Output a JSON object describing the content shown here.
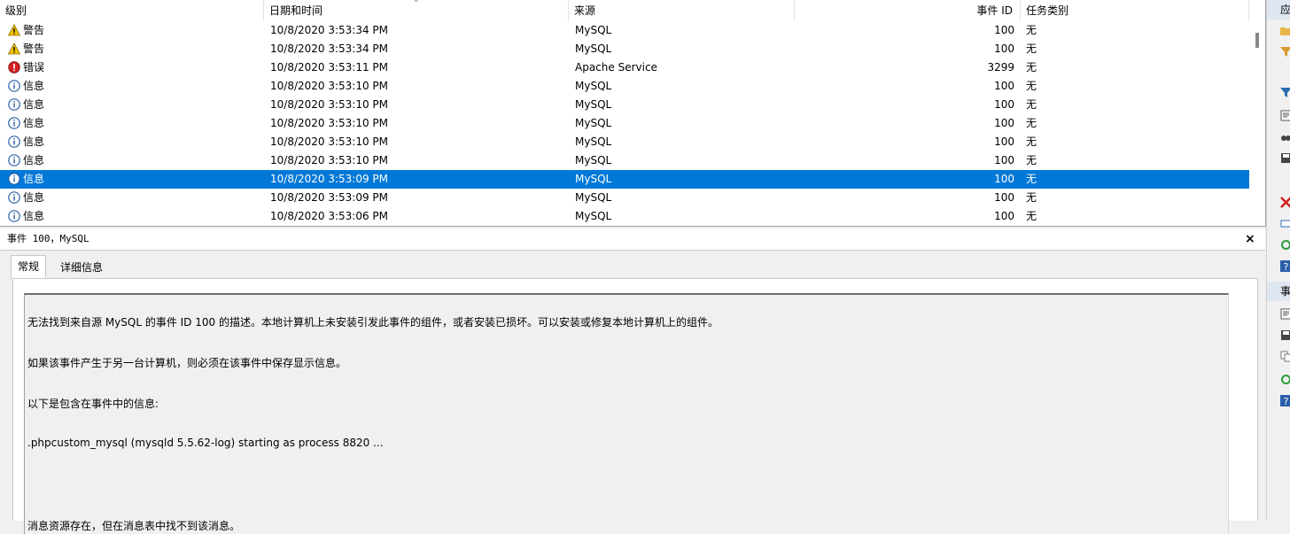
{
  "columns": {
    "level": "级别",
    "datetime": "日期和时间",
    "source": "来源",
    "event_id": "事件 ID",
    "task": "任务类别"
  },
  "rows": [
    {
      "level": "警告",
      "type": "warning",
      "datetime": "10/8/2020 3:53:34 PM",
      "source": "MySQL",
      "event_id": "100",
      "task": "无",
      "selected": false
    },
    {
      "level": "警告",
      "type": "warning",
      "datetime": "10/8/2020 3:53:34 PM",
      "source": "MySQL",
      "event_id": "100",
      "task": "无",
      "selected": false
    },
    {
      "level": "错误",
      "type": "error",
      "datetime": "10/8/2020 3:53:11 PM",
      "source": "Apache Service",
      "event_id": "3299",
      "task": "无",
      "selected": false
    },
    {
      "level": "信息",
      "type": "info",
      "datetime": "10/8/2020 3:53:10 PM",
      "source": "MySQL",
      "event_id": "100",
      "task": "无",
      "selected": false
    },
    {
      "level": "信息",
      "type": "info",
      "datetime": "10/8/2020 3:53:10 PM",
      "source": "MySQL",
      "event_id": "100",
      "task": "无",
      "selected": false
    },
    {
      "level": "信息",
      "type": "info",
      "datetime": "10/8/2020 3:53:10 PM",
      "source": "MySQL",
      "event_id": "100",
      "task": "无",
      "selected": false
    },
    {
      "level": "信息",
      "type": "info",
      "datetime": "10/8/2020 3:53:10 PM",
      "source": "MySQL",
      "event_id": "100",
      "task": "无",
      "selected": false
    },
    {
      "level": "信息",
      "type": "info",
      "datetime": "10/8/2020 3:53:10 PM",
      "source": "MySQL",
      "event_id": "100",
      "task": "无",
      "selected": false
    },
    {
      "level": "信息",
      "type": "info",
      "datetime": "10/8/2020 3:53:09 PM",
      "source": "MySQL",
      "event_id": "100",
      "task": "无",
      "selected": true
    },
    {
      "level": "信息",
      "type": "info",
      "datetime": "10/8/2020 3:53:09 PM",
      "source": "MySQL",
      "event_id": "100",
      "task": "无",
      "selected": false
    },
    {
      "level": "信息",
      "type": "info",
      "datetime": "10/8/2020 3:53:06 PM",
      "source": "MySQL",
      "event_id": "100",
      "task": "无",
      "selected": false
    }
  ],
  "detail": {
    "title": "事件 100，MySQL",
    "close": "×",
    "tabs": [
      "常规",
      "详细信息"
    ],
    "messages": [
      "无法找到来自源 MySQL 的事件 ID 100 的描述。本地计算机上未安装引发此事件的组件，或者安装已损坏。可以安装或修复本地计算机上的组件。",
      "如果该事件产生于另一台计算机，则必须在该事件中保存显示信息。",
      "以下是包含在事件中的信息:",
      ".phpcustom_mysql (mysqld 5.5.62-log) starting as process 8820 ...",
      "消息资源存在，但在消息表中找不到该消息。"
    ]
  },
  "right_panel": {
    "section1": "应",
    "section2": "事"
  },
  "colors": {
    "selection": "#0078d7",
    "warning": "#f5c400",
    "error": "#d32020",
    "info": "#2b5fa8"
  }
}
